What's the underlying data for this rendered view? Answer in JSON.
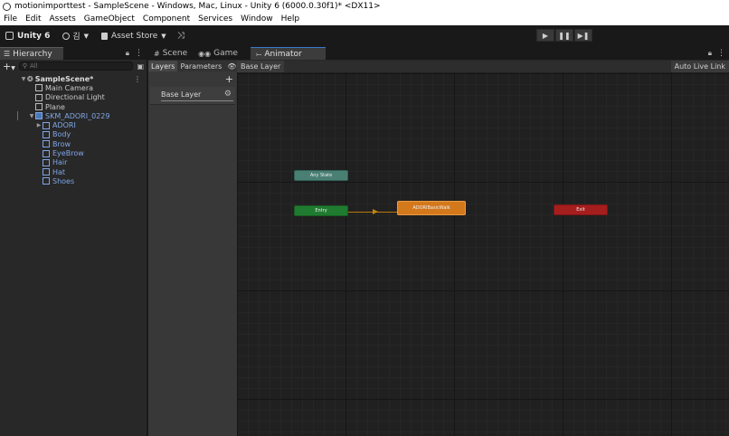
{
  "window": {
    "title": "motionimporttest - SampleScene - Windows, Mac, Linux - Unity 6 (6000.0.30f1)* <DX11>"
  },
  "menu": [
    "File",
    "Edit",
    "Assets",
    "GameObject",
    "Component",
    "Services",
    "Window",
    "Help"
  ],
  "toolbar": {
    "unity_label": "Unity 6",
    "account_label": "김",
    "asset_store_label": "Asset Store"
  },
  "hierarchy": {
    "tab_label": "Hierarchy",
    "search_placeholder": "All",
    "scene": "SampleScene*",
    "items": [
      {
        "label": "Main Camera"
      },
      {
        "label": "Directional Light"
      },
      {
        "label": "Plane"
      },
      {
        "label": "SKM_ADORI_0229"
      },
      {
        "label": "ADORI"
      },
      {
        "label": "Body"
      },
      {
        "label": "Brow"
      },
      {
        "label": "EyeBrow"
      },
      {
        "label": "Hair"
      },
      {
        "label": "Hat"
      },
      {
        "label": "Shoes"
      }
    ]
  },
  "tabs": {
    "scene": "Scene",
    "game": "Game",
    "animator": "Animator"
  },
  "animator": {
    "layers_tab": "Layers",
    "parameters_tab": "Parameters",
    "breadcrumb": "Base Layer",
    "auto_live_link": "Auto Live Link",
    "layer_item": "Base Layer",
    "nodes": {
      "any_state": "Any State",
      "entry": "Entry",
      "default_state": "ADORIBasicWalk",
      "exit": "Exit"
    }
  }
}
